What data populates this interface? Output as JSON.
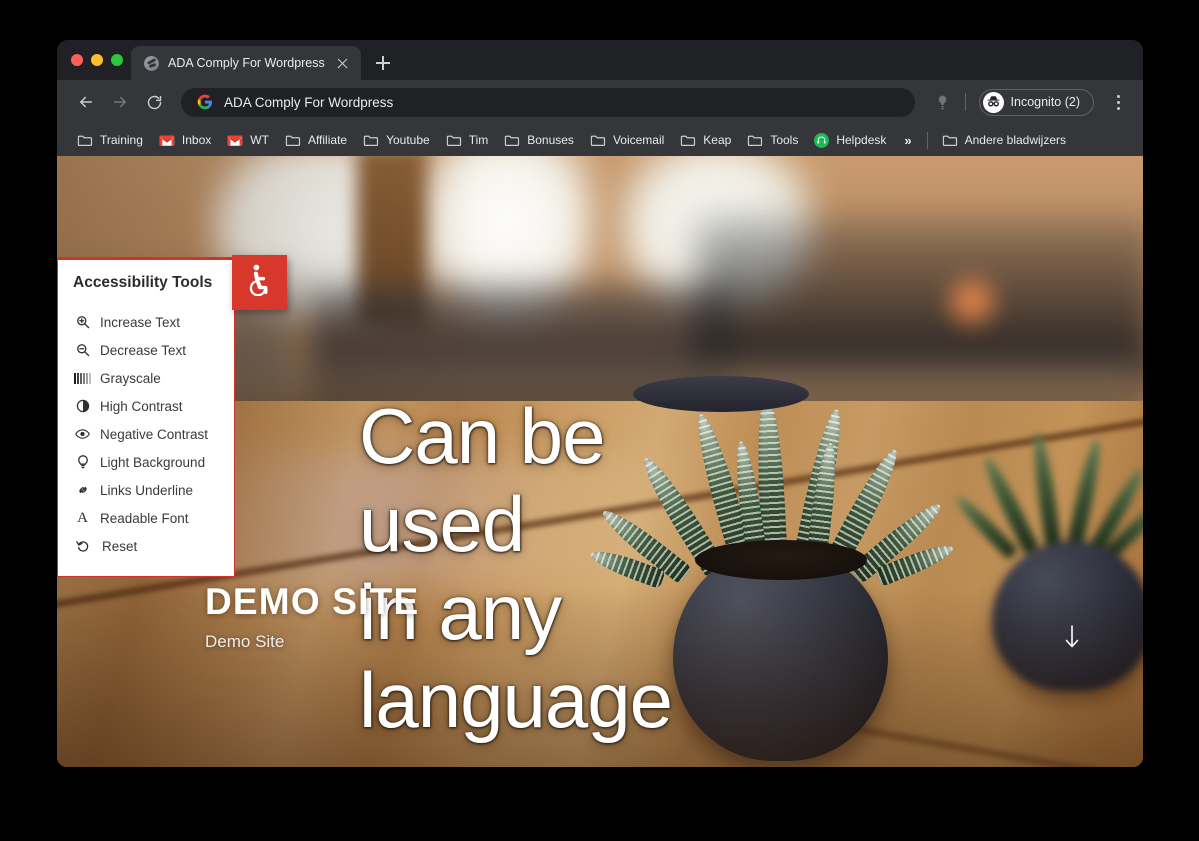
{
  "browser": {
    "tab": {
      "title": "ADA Comply For Wordpress",
      "favicon": "globe-icon",
      "close": "close-icon"
    },
    "new_tab": "new-tab-icon",
    "toolbar": {
      "back": "back-arrow-icon",
      "forward": "forward-arrow-icon",
      "reload": "reload-icon",
      "omnibox_value": "ADA Comply For Wordpress",
      "omnibox_icon": "google-g-icon",
      "profile_icon": "profile-icon",
      "incognito_label": "Incognito (2)",
      "incognito_icon": "incognito-hat-icon",
      "menu": "three-dots-icon"
    },
    "bookmarks": [
      {
        "label": "Training",
        "icon": "folder-icon"
      },
      {
        "label": "Inbox",
        "icon": "gmail-icon"
      },
      {
        "label": "WT",
        "icon": "gmail-icon"
      },
      {
        "label": "Affiliate",
        "icon": "folder-icon"
      },
      {
        "label": "Youtube",
        "icon": "folder-icon"
      },
      {
        "label": "Tim",
        "icon": "folder-icon"
      },
      {
        "label": "Bonuses",
        "icon": "folder-icon"
      },
      {
        "label": "Voicemail",
        "icon": "folder-icon"
      },
      {
        "label": "Keap",
        "icon": "folder-icon"
      },
      {
        "label": "Tools",
        "icon": "folder-icon"
      },
      {
        "label": "Helpdesk",
        "icon": "headset-badge-icon"
      }
    ],
    "bookmarks_overflow": "»",
    "other_bookmarks": {
      "label": "Andere bladwijzers",
      "icon": "folder-icon"
    }
  },
  "accessibility_panel": {
    "title": "Accessibility Tools",
    "launcher_icon": "wheelchair-icon",
    "accent_color": "#d8372b",
    "items": [
      {
        "label": "Increase Text",
        "icon": "zoom-in-icon"
      },
      {
        "label": "Decrease Text",
        "icon": "zoom-out-icon"
      },
      {
        "label": "Grayscale",
        "icon": "bars-icon"
      },
      {
        "label": "High Contrast",
        "icon": "contrast-circle-icon"
      },
      {
        "label": "Negative Contrast",
        "icon": "eye-icon"
      },
      {
        "label": "Light Background",
        "icon": "lightbulb-icon"
      },
      {
        "label": "Links Underline",
        "icon": "link-chain-icon"
      },
      {
        "label": "Readable Font",
        "icon": "letter-a-icon"
      },
      {
        "label": "Reset",
        "icon": "reset-arrow-icon"
      }
    ]
  },
  "page": {
    "heading_lines": [
      "Can be",
      "used",
      "in any",
      "language"
    ],
    "site_title": "DEMO SITE",
    "site_tagline": "Demo Site",
    "scroll_hint_icon": "down-arrow-icon"
  }
}
